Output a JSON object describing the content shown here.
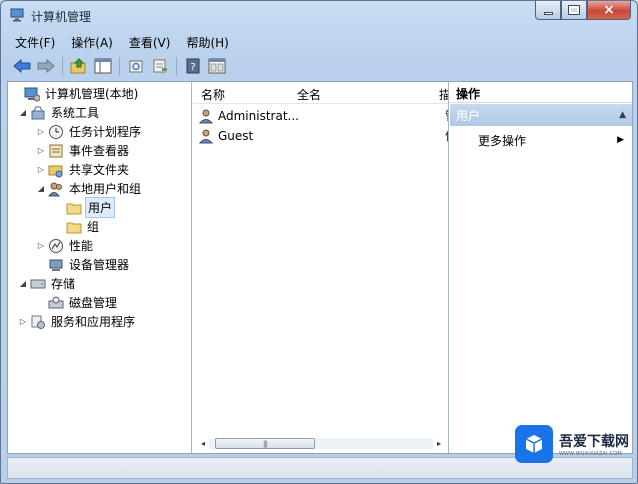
{
  "window": {
    "title": "计算机管理",
    "controls": {
      "minimize": "minimize",
      "maximize": "maximize",
      "close": "close"
    }
  },
  "menubar": {
    "items": [
      {
        "label": "文件(F)"
      },
      {
        "label": "操作(A)"
      },
      {
        "label": "查看(V)"
      },
      {
        "label": "帮助(H)"
      }
    ]
  },
  "toolbar": {
    "buttons": [
      "back-arrow-icon",
      "forward-arrow-icon",
      "up-folder-icon",
      "show-hide-tree-icon",
      "refresh-icon",
      "export-list-icon",
      "help-icon",
      "properties-icon"
    ]
  },
  "tree": {
    "items": [
      {
        "label": "计算机管理(本地)",
        "icon": "computer-management-icon",
        "expander": ""
      },
      {
        "label": "系统工具",
        "icon": "tools-icon",
        "expander": "◢"
      },
      {
        "label": "任务计划程序",
        "icon": "clock-icon",
        "expander": "▷"
      },
      {
        "label": "事件查看器",
        "icon": "event-viewer-icon",
        "expander": "▷"
      },
      {
        "label": "共享文件夹",
        "icon": "shared-folder-icon",
        "expander": "▷"
      },
      {
        "label": "本地用户和组",
        "icon": "users-icon",
        "expander": "◢"
      },
      {
        "label": "用户",
        "icon": "folder-icon",
        "expander": "",
        "selected": true
      },
      {
        "label": "组",
        "icon": "folder-icon",
        "expander": ""
      },
      {
        "label": "性能",
        "icon": "performance-icon",
        "expander": "▷"
      },
      {
        "label": "设备管理器",
        "icon": "device-manager-icon",
        "expander": ""
      },
      {
        "label": "存储",
        "icon": "storage-icon",
        "expander": "◢"
      },
      {
        "label": "磁盘管理",
        "icon": "disk-management-icon",
        "expander": ""
      },
      {
        "label": "服务和应用程序",
        "icon": "services-icon",
        "expander": "▷"
      }
    ]
  },
  "list": {
    "columns": [
      "名称",
      "全名",
      "描"
    ],
    "rows": [
      {
        "name": "Administrat...",
        "full_name": "",
        "desc": "管"
      },
      {
        "name": "Guest",
        "full_name": "",
        "desc": "供"
      }
    ],
    "scrollbar": {
      "left_arrow": "◂",
      "right_arrow": "▸",
      "grip": "|||"
    }
  },
  "actions": {
    "title": "操作",
    "section": "用户",
    "collapse_glyph": "▲",
    "more": "更多操作",
    "more_arrow": "▶"
  },
  "watermark": {
    "name": "吾爱下载网",
    "url": "WWW.WUAIXIAZAI.COM"
  },
  "colors": {
    "accent": "#1a73e8",
    "selection": "#dfeafb",
    "section_header": "#b1c7e6"
  }
}
